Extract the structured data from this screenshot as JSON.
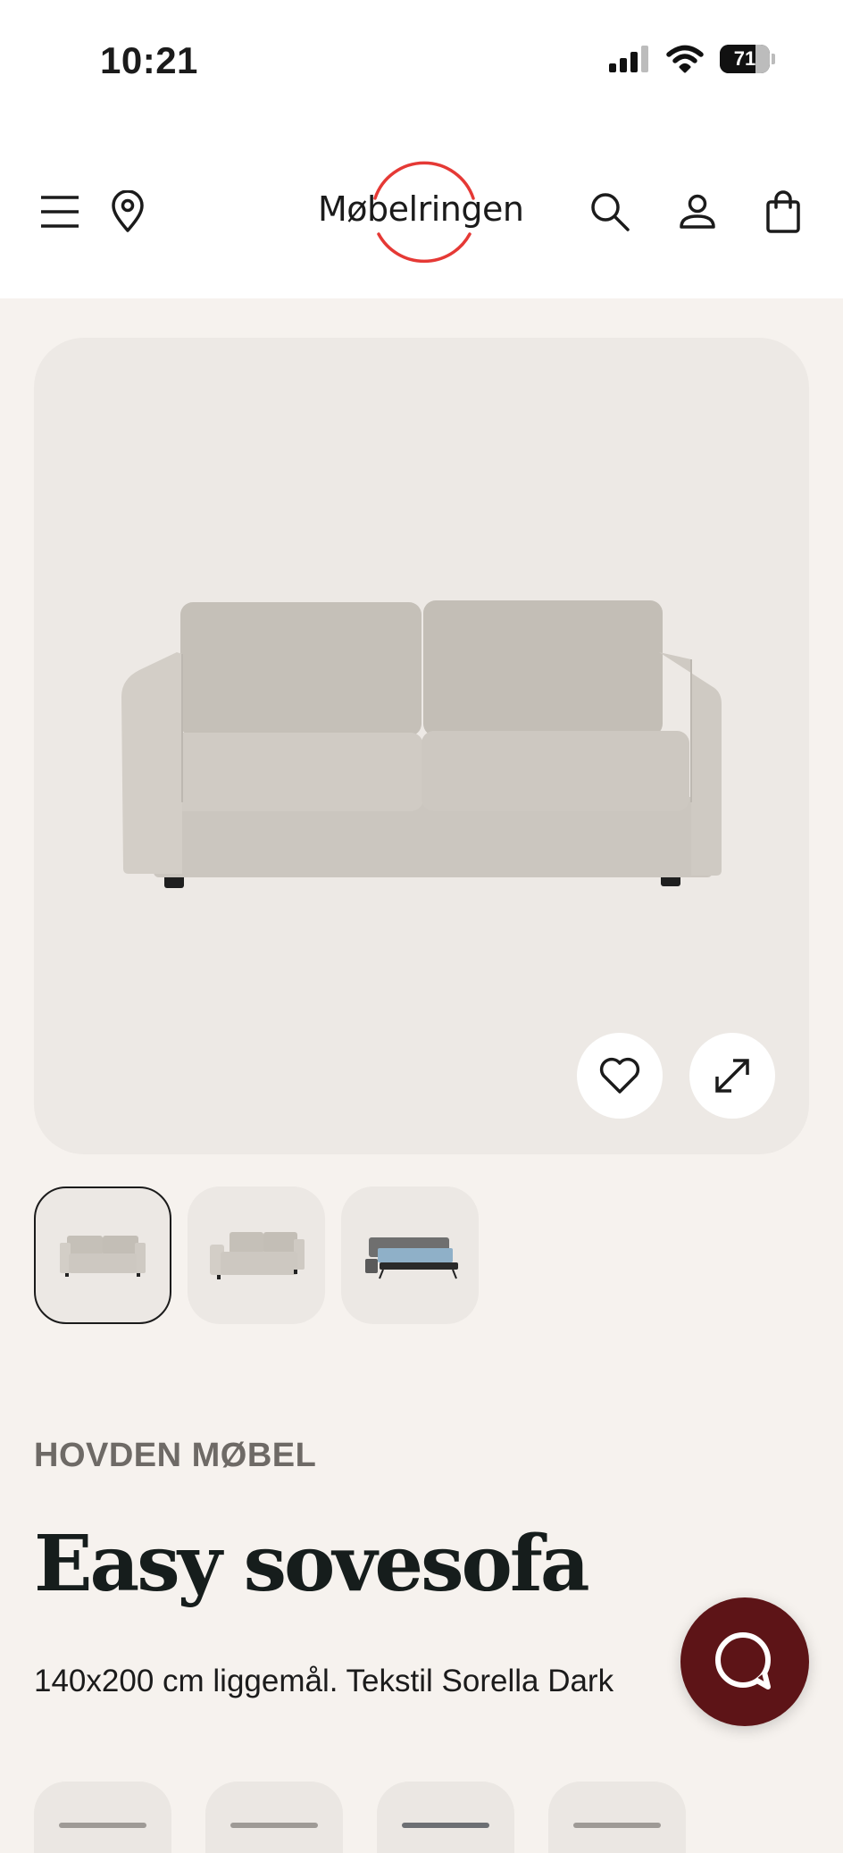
{
  "status_bar": {
    "time": "10:21",
    "battery": "71"
  },
  "header": {
    "logo": "Møbelringen",
    "logo_ring_color": "#e53935",
    "icons": [
      "menu-icon",
      "location-pin-icon",
      "search-icon",
      "user-icon",
      "shopping-bag-icon"
    ]
  },
  "gallery": {
    "main_image": "sofa-front",
    "thumbnails": [
      "sofa-front",
      "sofa-angle",
      "sofa-bed-open"
    ],
    "active_thumbnail": 1
  },
  "product": {
    "brand": "HOVDEN MØBEL",
    "title": "Easy sovesofa",
    "description": "140x200 cm liggemål. Tekstil Sorella Dark"
  },
  "colors": {
    "page_background": "#f6f2ee",
    "gallery_background": "#ede9e5",
    "chat_button": "#5d1417",
    "brand_text": "#6e6a66"
  }
}
